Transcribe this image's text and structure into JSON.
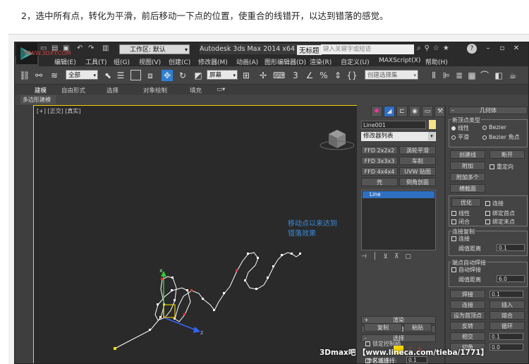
{
  "caption": "2，选中所有点，转化为平滑，前后移动一下点的位置，使重合的线错开，以达到错落的感觉。",
  "titlebar": {
    "workspace_label": "工作区: 默认",
    "title": "Autodesk 3ds Max  2014 x64",
    "title_suffix": "无标题",
    "search_placeholder": "键入关键字或短语",
    "help_label": "?"
  },
  "watermark_small": "WWW.3DXY.COM",
  "menu": [
    "编辑(E)",
    "工具(T)",
    "组(G)",
    "视图(V)",
    "创建(C)",
    "修改器(M)",
    "动画(A)",
    "图形编辑器(D)",
    "渲染(R)",
    "自定义(U)",
    "MAXScript(X)",
    "帮助(H)"
  ],
  "toolbar": {
    "filter_select": "全部",
    "coord_select": "屏幕",
    "named_sel_placeholder": "创建选择集"
  },
  "ribbon": {
    "tabs": [
      "建模",
      "自由形式",
      "选择",
      "对象绘制",
      "填充"
    ],
    "subtab": "多边形建模"
  },
  "viewport": {
    "label": "[+] [正交] [真实]",
    "annotation_line1": "移动点以来达到",
    "annotation_line2": "错落效果",
    "axis_z": "z",
    "axis_x": "x"
  },
  "command_panel": {
    "object_name": "Line001",
    "modifier_list": "修改器列表",
    "modifier_buttons": [
      [
        "FFD 2x2x2",
        "涡轮平滑"
      ],
      [
        "FFD 3x3x3",
        "车削"
      ],
      [
        "FFD 4x4x4",
        "UVW 贴图"
      ],
      [
        "壳",
        "倒角剖面"
      ]
    ],
    "stack_item": "Line",
    "rollouts": [
      "渲染",
      "插值",
      "选择"
    ],
    "named_selection_label": "命名选择:",
    "copy_label": "复制",
    "paste_label": "粘贴",
    "lock_handles_label": "锁定控制柄",
    "area_select_label": "区域选择:",
    "area_value": "0.1"
  },
  "geometry_panel": {
    "title": "几何体",
    "new_vertex_type": "新顶点类型",
    "radio_linear": "线性",
    "radio_bezier": "Bezier",
    "radio_smooth": "平滑",
    "radio_bezier_corner": "Bezier 角点",
    "create_line": "创建线",
    "break": "断开",
    "attach": "附加",
    "reorient": "重定向",
    "attach_multi": "附加多个",
    "cross_section": "横截面",
    "refine": "优化",
    "connect_chk": "连接",
    "linear_chk": "线性",
    "bind_first": "绑定首点",
    "closed_chk": "闭合",
    "bind_last": "绑定末点",
    "connect_copy": "连接复制",
    "connect_copy_chk": "连接",
    "threshold_label": "阈值距离",
    "threshold_value": "0.1",
    "auto_weld": "端点自动焊接",
    "auto_weld_chk": "自动焊接",
    "weld_threshold_label": "阈值距离",
    "weld_threshold_value": "6.0",
    "weld": "焊接",
    "weld_value": "0.1",
    "connect": "连接",
    "insert": "插入",
    "make_first": "设为首顶点",
    "fuse": "熔合",
    "reverse": "反转",
    "cycle": "循环",
    "cross_insert": "相交",
    "cross_value": "0.1",
    "chamfer": "切角",
    "chamfer_value": "0.0"
  },
  "watermark": "3Dmax吧 【www.lineca.com/tieba/1771】"
}
